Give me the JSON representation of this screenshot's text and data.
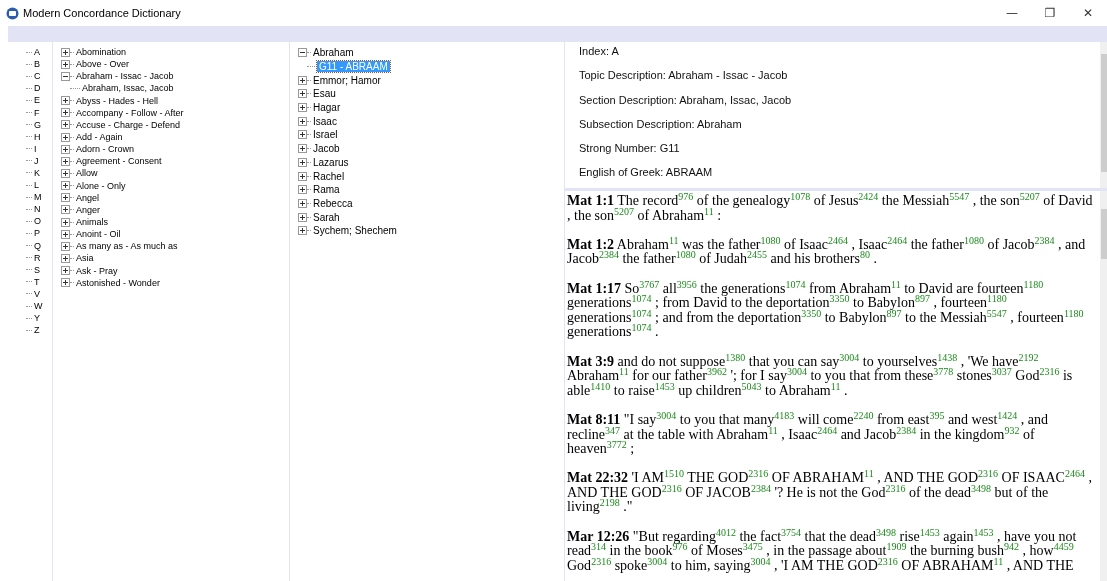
{
  "window": {
    "title": "Modern Concordance Dictionary",
    "controls": [
      "—",
      "❐",
      "✕"
    ]
  },
  "index_tree": {
    "items": [
      {
        "label": "A",
        "selected": false
      },
      {
        "label": "B",
        "selected": false
      },
      {
        "label": "C",
        "selected": false
      },
      {
        "label": "D",
        "selected": false
      },
      {
        "label": "E",
        "selected": false
      },
      {
        "label": "F",
        "selected": false
      },
      {
        "label": "G",
        "selected": false
      },
      {
        "label": "H",
        "selected": false
      },
      {
        "label": "I",
        "selected": false
      },
      {
        "label": "J",
        "selected": false
      },
      {
        "label": "K",
        "selected": false
      },
      {
        "label": "L",
        "selected": false
      },
      {
        "label": "M",
        "selected": false
      },
      {
        "label": "N",
        "selected": false
      },
      {
        "label": "O",
        "selected": false
      },
      {
        "label": "P",
        "selected": false
      },
      {
        "label": "Q",
        "selected": false
      },
      {
        "label": "R",
        "selected": false
      },
      {
        "label": "S",
        "selected": false
      },
      {
        "label": "T",
        "selected": false
      },
      {
        "label": "V",
        "selected": false
      },
      {
        "label": "W",
        "selected": false
      },
      {
        "label": "Y",
        "selected": false
      },
      {
        "label": "Z",
        "selected": false
      }
    ]
  },
  "topic_tree": {
    "items": [
      {
        "label": "Abomination",
        "expanded": false,
        "selected": false
      },
      {
        "label": "Above - Over",
        "expanded": false,
        "selected": false
      },
      {
        "label": "Abraham - Issac - Jacob",
        "expanded": true,
        "selected": false,
        "children": [
          {
            "label": "Abraham, Issac, Jacob",
            "selected": false
          }
        ]
      },
      {
        "label": "Abyss - Hades - Hell",
        "expanded": false,
        "selected": false
      },
      {
        "label": "Accompany - Follow - After",
        "expanded": false,
        "selected": false
      },
      {
        "label": "Accuse - Charge - Defend",
        "expanded": false,
        "selected": false
      },
      {
        "label": "Add - Again",
        "expanded": false,
        "selected": false
      },
      {
        "label": "Adorn - Crown",
        "expanded": false,
        "selected": false
      },
      {
        "label": "Agreement - Consent",
        "expanded": false,
        "selected": false
      },
      {
        "label": "Allow",
        "expanded": false,
        "selected": false
      },
      {
        "label": "Alone - Only",
        "expanded": false,
        "selected": false
      },
      {
        "label": "Angel",
        "expanded": false,
        "selected": false
      },
      {
        "label": "Anger",
        "expanded": false,
        "selected": false
      },
      {
        "label": "Animals",
        "expanded": false,
        "selected": false
      },
      {
        "label": "Anoint - Oil",
        "expanded": false,
        "selected": false
      },
      {
        "label": "As many as - As much as",
        "expanded": false,
        "selected": false
      },
      {
        "label": "Asia",
        "expanded": false,
        "selected": false
      },
      {
        "label": "Ask - Pray",
        "expanded": false,
        "selected": false
      },
      {
        "label": "Astonished - Wonder",
        "expanded": false,
        "selected": false
      }
    ]
  },
  "subsection_tree": {
    "items": [
      {
        "label": "Abraham",
        "expanded": true,
        "selected": false,
        "children": [
          {
            "label": "G11 - ABRAAM",
            "selected": true
          }
        ]
      },
      {
        "label": "Emmor; Hamor",
        "expanded": false,
        "selected": false
      },
      {
        "label": "Esau",
        "expanded": false,
        "selected": false
      },
      {
        "label": "Hagar",
        "expanded": false,
        "selected": false
      },
      {
        "label": "Isaac",
        "expanded": false,
        "selected": false
      },
      {
        "label": "Israel",
        "expanded": false,
        "selected": false
      },
      {
        "label": "Jacob",
        "expanded": false,
        "selected": false
      },
      {
        "label": "Lazarus",
        "expanded": false,
        "selected": false
      },
      {
        "label": "Rachel",
        "expanded": false,
        "selected": false
      },
      {
        "label": "Rama",
        "expanded": false,
        "selected": false
      },
      {
        "label": "Rebecca",
        "expanded": false,
        "selected": false
      },
      {
        "label": "Sarah",
        "expanded": false,
        "selected": false
      },
      {
        "label": "Sychem; Shechem",
        "expanded": false,
        "selected": false
      }
    ]
  },
  "details": [
    "Index: A",
    "Topic Description: Abraham - Issac - Jacob",
    "Section Description: Abraham, Issac, Jacob",
    "Subsection Description: Abraham",
    "Strong Number: G11",
    "English of Greek: ABRAAM"
  ],
  "verses": [
    {
      "ref": "Mat 1:1",
      "text": "The record$^{976}$ of the genealogy$^{1078}$ of Jesus$^{2424}$ the Messiah$^{5547}$ , the son$^{5207}$ of David , the son$^{5207}$ of Abraham$^{11}$ :"
    },
    {
      "ref": "Mat 1:2",
      "text": "Abraham$^{11}$ was the father$^{1080}$ of Isaac$^{2464}$ , Isaac$^{2464}$ the father$^{1080}$ of Jacob$^{2384}$ , and Jacob$^{2384}$ the father$^{1080}$ of Judah$^{2455}$ and his brothers$^{80}$ ."
    },
    {
      "ref": "Mat 1:17",
      "text": "So$^{3767}$ all$^{3956}$ the generations$^{1074}$ from Abraham$^{11}$ to David are fourteen$^{1180}$ generations$^{1074}$ ; from David to the deportation$^{3350}$ to Babylon$^{897}$ , fourteen$^{1180}$ generations$^{1074}$ ; and from the deportation$^{3350}$ to Babylon$^{897}$ to the Messiah$^{5547}$ , fourteen$^{1180}$ generations$^{1074}$ ."
    },
    {
      "ref": "Mat 3:9",
      "text": "and do not suppose$^{1380}$ that you can say$^{3004}$ to yourselves$^{1438}$ , 'We have$^{2192}$ Abraham$^{11}$ for our father$^{3962}$ '; for I say$^{3004}$ to you that from these$^{3778}$ stones$^{3037}$ God$^{2316}$ is able$^{1410}$ to raise$^{1453}$ up children$^{5043}$ to Abraham$^{11}$ ."
    },
    {
      "ref": "Mat 8:11",
      "text": "\"I say$^{3004}$ to you that many$^{4183}$ will come$^{2240}$ from east$^{395}$ and west$^{1424}$ , and recline$^{347}$ at the table with Abraham$^{11}$ , Isaac$^{2464}$ and Jacob$^{2384}$ in the kingdom$^{932}$ of heaven$^{3772}$ ;"
    },
    {
      "ref": "Mat 22:32",
      "text": "'I AM$^{1510}$ THE GOD$^{2316}$ OF ABRAHAM$^{11}$ , AND THE GOD$^{2316}$ OF ISAAC$^{2464}$ , AND THE GOD$^{2316}$ OF JACOB$^{2384}$ '? He is not the God$^{2316}$ of the dead$^{3498}$ but of the living$^{2198}$ .\""
    },
    {
      "ref": "Mar 12:26",
      "text": "\"But regarding$^{4012}$ the fact$^{3754}$ that the dead$^{3498}$ rise$^{1453}$ again$^{1453}$ , have you not read$^{314}$ in the book$^{976}$ of Moses$^{3475}$ , in the passage about$^{1909}$ the burning bush$^{942}$ , how$^{4459}$ God$^{2316}$ spoke$^{3004}$ to him, saying$^{3004}$ , 'I AM THE GOD$^{2316}$ OF ABRAHAM$^{11}$ , AND THE"
    }
  ]
}
